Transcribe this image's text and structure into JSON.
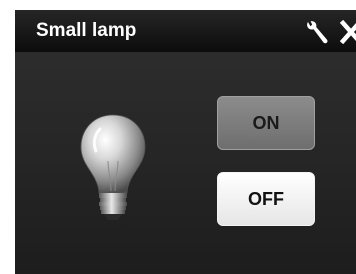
{
  "header": {
    "title": "Small lamp",
    "wrench_icon": "wrench-icon",
    "close_icon": "close-icon"
  },
  "lamp": {
    "icon": "light-bulb-icon"
  },
  "controls": {
    "on_label": "ON",
    "off_label": "OFF"
  },
  "colors": {
    "background": "#262626",
    "titlebar": "#0c0c0c",
    "on_button": "#7a7a7a",
    "off_button": "#ffffff"
  }
}
